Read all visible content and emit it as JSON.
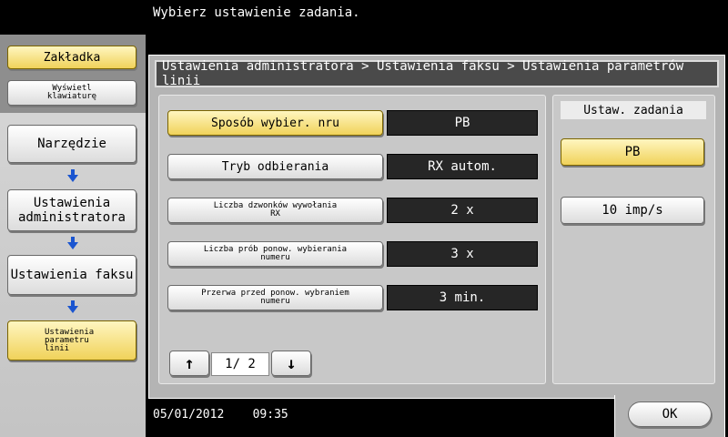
{
  "header": {
    "message": "Wybierz ustawienie zadania."
  },
  "sidebar": {
    "bookmark_label": "Zakładka",
    "keyboard_label": "Wyświetl klawiaturę",
    "tool_label": "Narzędzie",
    "admin_label": "Ustawienia administratora",
    "fax_label": "Ustawienia faksu",
    "line_label": "Ustawienia parametru linii"
  },
  "breadcrumb": "Ustawienia administratora > Ustawienia faksu > Ustawienia parametrów linii",
  "settings": {
    "rows": [
      {
        "label": "Sposób wybier. nru",
        "value": "PB"
      },
      {
        "label": "Tryb odbierania",
        "value": "RX autom."
      },
      {
        "label": "Liczba dzwonków wywołania RX",
        "value": "2  x"
      },
      {
        "label": "Liczba prób ponow. wybierania numeru",
        "value": "3  x"
      },
      {
        "label": "Przerwa przed ponow. wybraniem numeru",
        "value": "3  min."
      }
    ]
  },
  "pager": {
    "text": "1/  2"
  },
  "job": {
    "title": "Ustaw. zadania",
    "options": [
      "PB",
      "10 imp/s"
    ]
  },
  "footer": {
    "date": "05/01/2012",
    "time": "09:35",
    "ok_label": "OK"
  }
}
